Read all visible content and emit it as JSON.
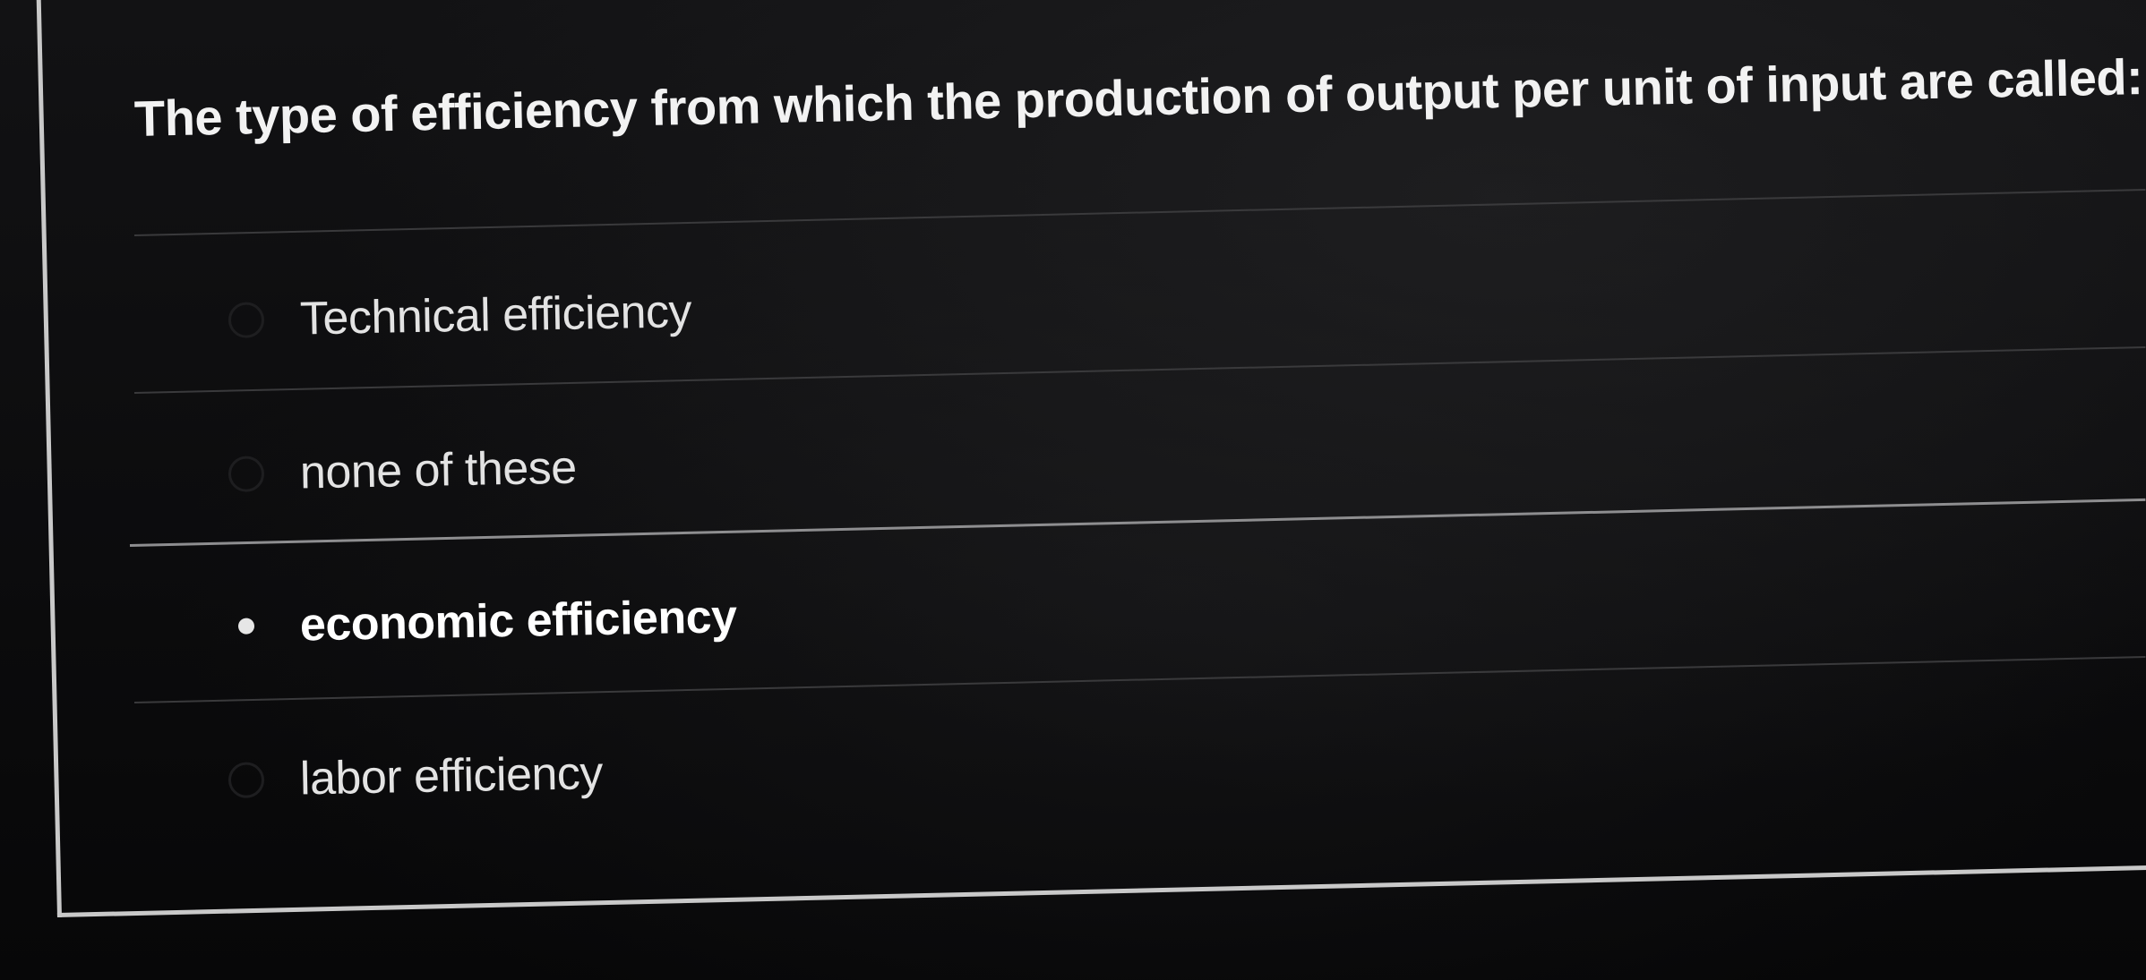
{
  "question": {
    "text": "The type of efficiency from which the production of output per unit of input are called:"
  },
  "answers": [
    {
      "label": "Technical efficiency",
      "selected": false
    },
    {
      "label": "none of these",
      "selected": false
    },
    {
      "label": "economic efficiency",
      "selected": true
    },
    {
      "label": "labor efficiency",
      "selected": false
    }
  ]
}
